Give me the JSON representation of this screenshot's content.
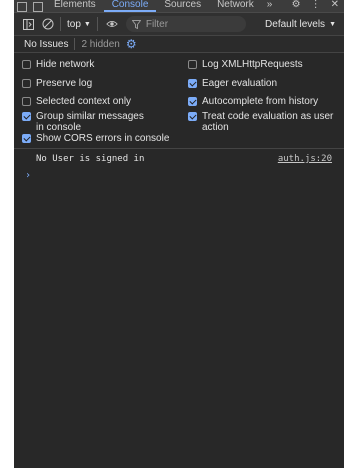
{
  "tabs": {
    "items": [
      "Elements",
      "Console",
      "Sources",
      "Network"
    ],
    "active": "Console",
    "more": "»",
    "menu": "⋮",
    "close": "✕"
  },
  "toolbar": {
    "context": "top",
    "filter_placeholder": "Filter",
    "levels": "Default levels"
  },
  "issues": {
    "label": "No Issues",
    "hidden": "2 hidden"
  },
  "settings": {
    "left": [
      {
        "label": "Hide network",
        "checked": false
      },
      {
        "label": "Preserve log",
        "checked": false
      },
      {
        "label": "Selected context only",
        "checked": false
      },
      {
        "label": "Group similar messages in console",
        "checked": true
      },
      {
        "label": "Show CORS errors in console",
        "checked": true
      }
    ],
    "right": [
      {
        "label": "Log XMLHttpRequests",
        "checked": false
      },
      {
        "label": "Eager evaluation",
        "checked": true
      },
      {
        "label": "Autocomplete from history",
        "checked": true
      },
      {
        "label": "Treat code evaluation as user action",
        "checked": true
      }
    ]
  },
  "log": {
    "message": "No User is signed in",
    "source": "auth.js:20",
    "prompt": "›"
  },
  "colors": {
    "accent": "#7cacf8",
    "panel": "#282828"
  }
}
